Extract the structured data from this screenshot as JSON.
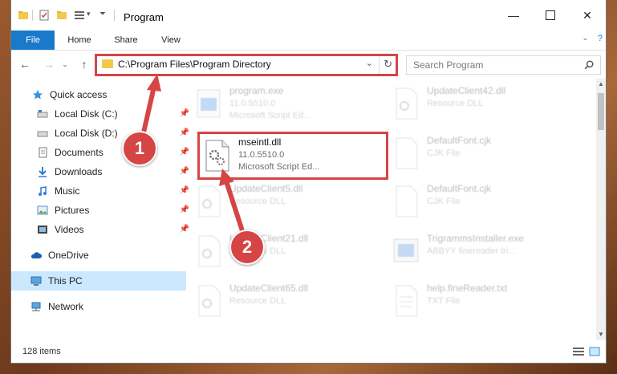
{
  "window": {
    "title": "Program"
  },
  "ribbon": {
    "tabs": [
      "File",
      "Home",
      "Share",
      "View"
    ]
  },
  "address": {
    "path": "C:\\Program Files\\Program Directory"
  },
  "search": {
    "placeholder": "Search Program"
  },
  "sidebar": {
    "items": [
      {
        "label": "Quick access",
        "icon": "star-icon"
      },
      {
        "label": "Local Disk (C:)",
        "icon": "drive-icon",
        "pinned": true
      },
      {
        "label": "Local Disk (D:)",
        "icon": "drive-icon",
        "pinned": true
      },
      {
        "label": "Documents",
        "icon": "document-icon",
        "pinned": true
      },
      {
        "label": "Downloads",
        "icon": "download-icon",
        "pinned": true
      },
      {
        "label": "Music",
        "icon": "music-icon",
        "pinned": true
      },
      {
        "label": "Pictures",
        "icon": "picture-icon",
        "pinned": true
      },
      {
        "label": "Videos",
        "icon": "video-icon",
        "pinned": true
      },
      {
        "label": "OneDrive",
        "icon": "cloud-icon"
      },
      {
        "label": "This PC",
        "icon": "computer-icon",
        "selected": true
      },
      {
        "label": "Network",
        "icon": "network-icon"
      }
    ]
  },
  "files": [
    {
      "name": "program.exe",
      "line2": "11.0.5510.0",
      "line3": "Microsoft Script Ed..."
    },
    {
      "name": "UpdateClient42.dll",
      "line2": "Resource DLL",
      "line3": ""
    },
    {
      "name": "mseintl.dll",
      "line2": "11.0.5510.0",
      "line3": "Microsoft Script Ed..."
    },
    {
      "name": "DefaultFont.cjk",
      "line2": "CJK File",
      "line3": ""
    },
    {
      "name": "UpdateClient5.dll",
      "line2": "Resource DLL",
      "line3": ""
    },
    {
      "name": "DefaultFont.cjk",
      "line2": "CJK File",
      "line3": ""
    },
    {
      "name": "UpdateClient21.dll",
      "line2": "Resource DLL",
      "line3": ""
    },
    {
      "name": "TrigrammsInstaller.exe",
      "line2": "ABBYY finereader tri...",
      "line3": ""
    },
    {
      "name": "UpdateClient65.dll",
      "line2": "Resource DLL",
      "line3": ""
    },
    {
      "name": "help.fineReader.txt",
      "line2": "TXT File",
      "line3": ""
    }
  ],
  "status": {
    "items": "128 items"
  },
  "callouts": [
    "1",
    "2"
  ],
  "colors": {
    "accent": "#1979ca",
    "highlight": "#d64545",
    "selected_bg": "#cce8ff"
  }
}
